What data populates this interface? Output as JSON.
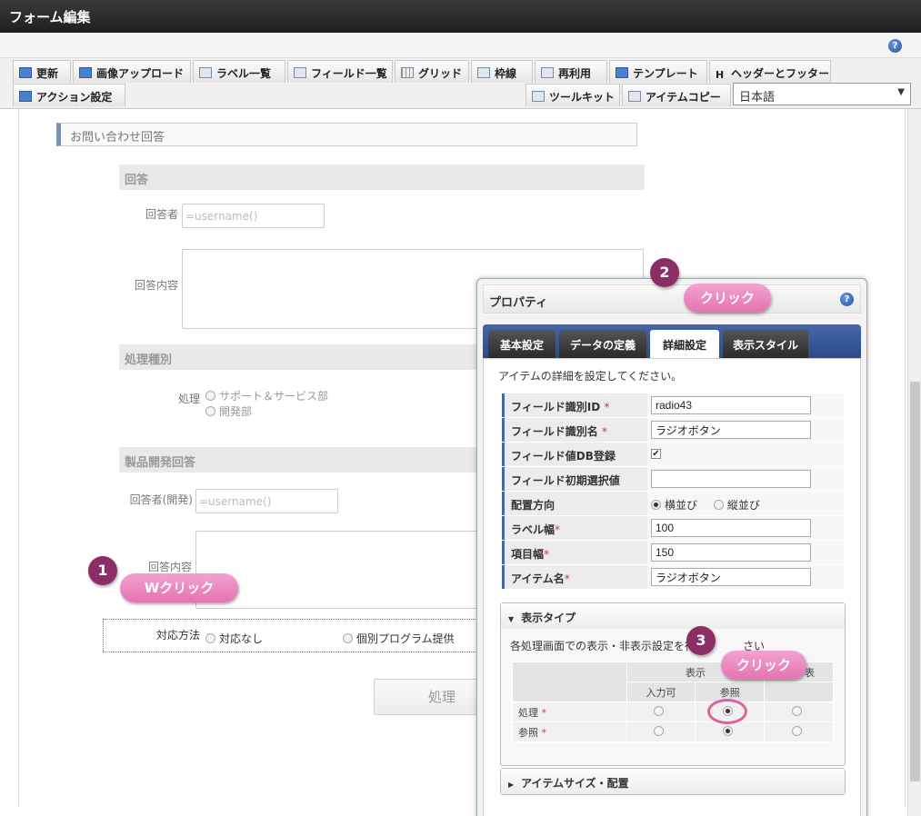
{
  "window": {
    "title": "フォーム編集"
  },
  "toolbar": {
    "row1": [
      "更新",
      "画像アップロード",
      "ラベル一覧",
      "フィールド一覧",
      "グリッド",
      "枠線",
      "再利用",
      "テンプレート",
      "ヘッダーとフッター"
    ],
    "row2": [
      "アクション設定",
      "ツールキット",
      "アイテムコピー"
    ],
    "help": "?",
    "language": "日本語"
  },
  "form": {
    "section_title": "お問い合わせ回答",
    "answer_head": "回答",
    "respondent_label": "回答者",
    "respondent_value": "=username()",
    "answer_content_label": "回答内容",
    "process_type_head": "処理種別",
    "process_label": "処理",
    "process_options": [
      "サポート＆サービス部",
      "開発部"
    ],
    "dev_answer_head": "製品開発回答",
    "dev_respondent_label": "回答者(開発)",
    "dev_respondent_value": "=username()",
    "dev_answer_content_label": "回答内容",
    "method_label": "対応方法",
    "method_options": [
      "対応なし",
      "個別プログラム提供"
    ],
    "process_button": "処理"
  },
  "panel": {
    "title": "プロパティ",
    "help": "?",
    "tabs": [
      "基本設定",
      "データの定義",
      "詳細設定",
      "表示スタイル"
    ],
    "active_tab": "詳細設定",
    "description": "アイテムの詳細を設定してください。",
    "rows": [
      {
        "label": "フィールド識別ID",
        "req": "*",
        "value": "radio43"
      },
      {
        "label": "フィールド識別名",
        "req": "*",
        "value": "ラジオボタン"
      },
      {
        "label": "フィールド値DB登録",
        "req": "",
        "checked": true
      },
      {
        "label": "フィールド初期選択値",
        "req": "",
        "value": ""
      },
      {
        "label": "配置方向",
        "req": "",
        "options": [
          "横並び",
          "縦並び"
        ]
      },
      {
        "label": "ラベル幅",
        "req": "*",
        "value": "100"
      },
      {
        "label": "項目幅",
        "req": "*",
        "value": "150"
      },
      {
        "label": "アイテム名",
        "req": "*",
        "value": "ラジオボタン"
      }
    ],
    "display_type": {
      "head": "表示タイプ",
      "note": "各処理画面での表示・非表示設定を行",
      "note_tail": "さい",
      "col_group": "表示",
      "col_group2": "表",
      "cols": [
        "入力可",
        "参照"
      ],
      "rows": [
        {
          "label": "処理",
          "req": "*"
        },
        {
          "label": "参照",
          "req": "*"
        }
      ]
    },
    "item_size_head": "アイテムサイズ・配置"
  },
  "callouts": [
    {
      "num": "1",
      "label": "Wクリック"
    },
    {
      "num": "2",
      "label": "クリック"
    },
    {
      "num": "3",
      "label": "クリック"
    }
  ]
}
